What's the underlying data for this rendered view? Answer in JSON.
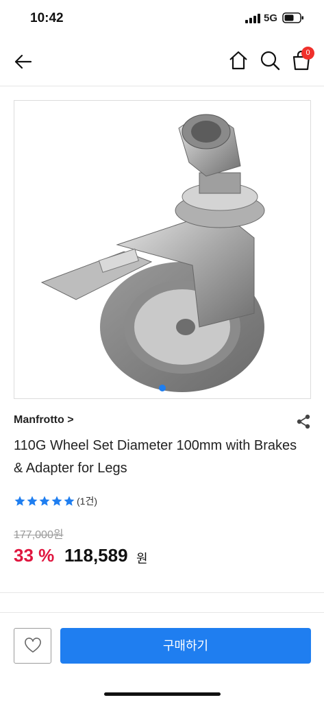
{
  "status_bar": {
    "time": "10:42",
    "network": "5G"
  },
  "header": {
    "cart_count": "0"
  },
  "product": {
    "brand": "Manfrotto >",
    "title": "110G Wheel Set Diameter 100mm with Brakes & Adapter for Legs",
    "rating_stars": 5,
    "review_count": "(1건)",
    "original_price": "177,000원",
    "discount_rate": "33 %",
    "sale_price": "118,589",
    "currency": "원"
  },
  "carousel": {
    "current_index": 1,
    "total": 1
  },
  "actions": {
    "buy_label": "구매하기"
  },
  "colors": {
    "accent": "#1f7ef0",
    "discount": "#e0163f",
    "badge": "#f0302b"
  },
  "icons": [
    "back-arrow-icon",
    "home-icon",
    "search-icon",
    "shopping-bag-icon",
    "share-icon",
    "star-icon",
    "heart-icon",
    "signal-icon",
    "battery-icon"
  ]
}
